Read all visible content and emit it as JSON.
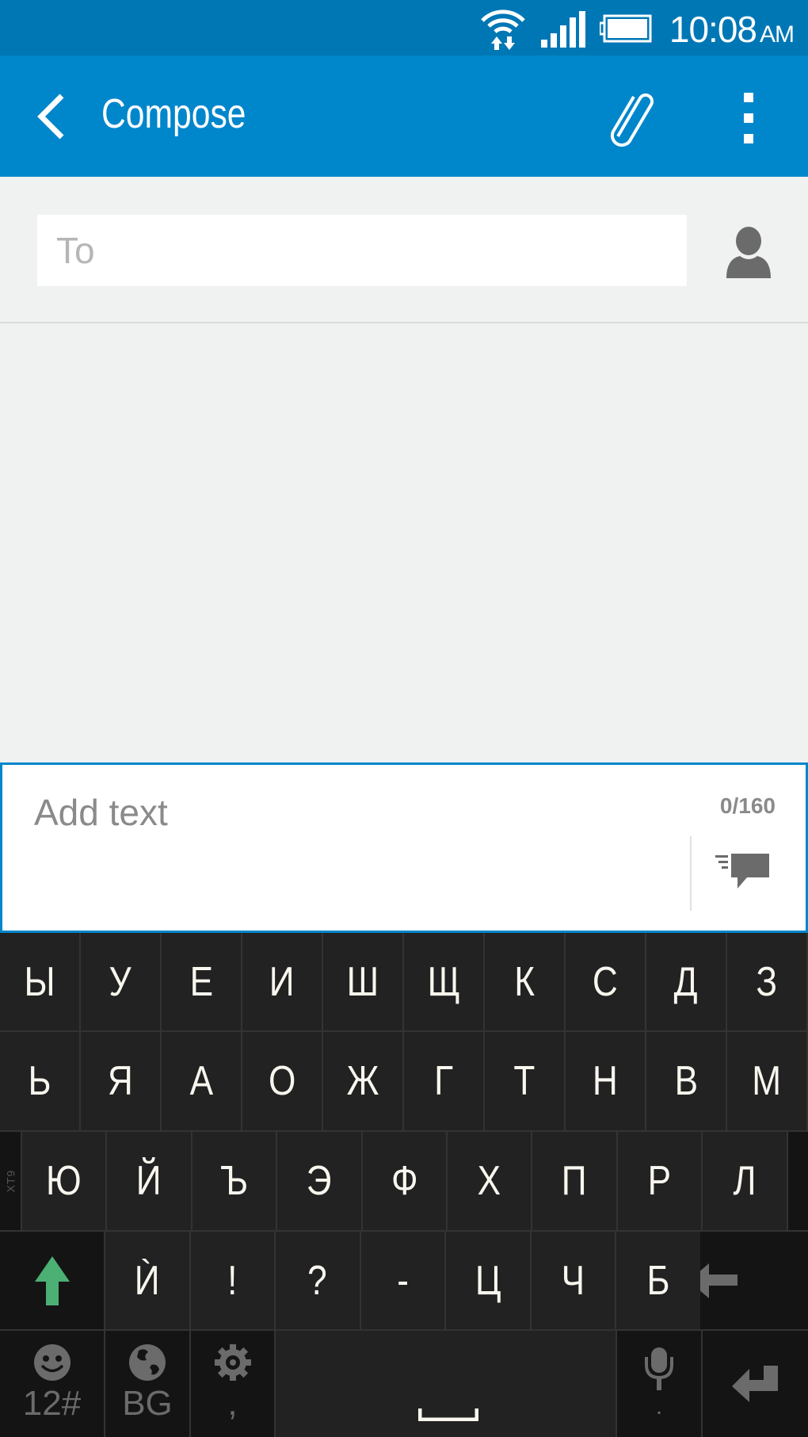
{
  "status_bar": {
    "time": "10:08",
    "ampm": "AM",
    "icons": [
      "wifi-data-icon",
      "signal-icon",
      "battery-icon"
    ]
  },
  "app_bar": {
    "title": "Compose",
    "back_icon": "back-chevron-icon",
    "attach_icon": "paperclip-icon",
    "more_icon": "overflow-menu-icon"
  },
  "recipient": {
    "placeholder": "To",
    "value": "",
    "contact_icon": "person-icon"
  },
  "compose": {
    "placeholder": "Add text",
    "value": "",
    "char_count": "0/160",
    "send_icon": "send-message-icon"
  },
  "keyboard": {
    "xt9_label": "XT9",
    "row1": [
      "Ы",
      "У",
      "Е",
      "И",
      "Ш",
      "Щ",
      "К",
      "С",
      "Д",
      "З"
    ],
    "row2": [
      "Ь",
      "Я",
      "А",
      "О",
      "Ж",
      "Г",
      "Т",
      "Н",
      "В",
      "М"
    ],
    "row3": [
      "Ю",
      "Й",
      "Ъ",
      "Э",
      "Ф",
      "Х",
      "П",
      "Р",
      "Л"
    ],
    "row4": [
      "Ѝ",
      "!",
      "?",
      "-",
      "Ц",
      "Ч",
      "Б"
    ],
    "symbols_label": "12#",
    "language_label": "BG",
    "comma_label": ",",
    "period_label": ".",
    "shift_icon": "shift-arrow-icon",
    "backspace_icon": "backspace-arrow-icon",
    "enter_icon": "enter-arrow-icon",
    "colors": {
      "shift": "#4caf74",
      "key_bg": "#222222",
      "fn_bg": "#141414",
      "key_text": "#f8f6ee"
    }
  },
  "colors": {
    "status_bar": "#0077b5",
    "app_bar": "#0086cb",
    "background": "#f0f1f1"
  }
}
